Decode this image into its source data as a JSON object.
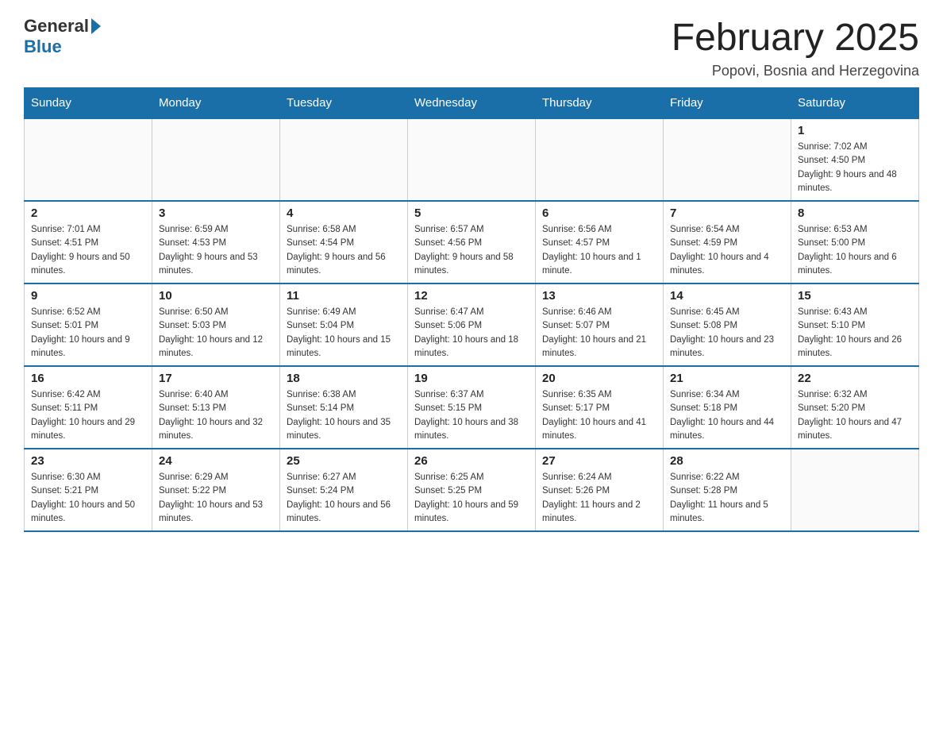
{
  "header": {
    "logo": {
      "general": "General",
      "blue": "Blue"
    },
    "title": "February 2025",
    "location": "Popovi, Bosnia and Herzegovina"
  },
  "days_of_week": [
    "Sunday",
    "Monday",
    "Tuesday",
    "Wednesday",
    "Thursday",
    "Friday",
    "Saturday"
  ],
  "weeks": [
    [
      {
        "day": "",
        "info": ""
      },
      {
        "day": "",
        "info": ""
      },
      {
        "day": "",
        "info": ""
      },
      {
        "day": "",
        "info": ""
      },
      {
        "day": "",
        "info": ""
      },
      {
        "day": "",
        "info": ""
      },
      {
        "day": "1",
        "info": "Sunrise: 7:02 AM\nSunset: 4:50 PM\nDaylight: 9 hours and 48 minutes."
      }
    ],
    [
      {
        "day": "2",
        "info": "Sunrise: 7:01 AM\nSunset: 4:51 PM\nDaylight: 9 hours and 50 minutes."
      },
      {
        "day": "3",
        "info": "Sunrise: 6:59 AM\nSunset: 4:53 PM\nDaylight: 9 hours and 53 minutes."
      },
      {
        "day": "4",
        "info": "Sunrise: 6:58 AM\nSunset: 4:54 PM\nDaylight: 9 hours and 56 minutes."
      },
      {
        "day": "5",
        "info": "Sunrise: 6:57 AM\nSunset: 4:56 PM\nDaylight: 9 hours and 58 minutes."
      },
      {
        "day": "6",
        "info": "Sunrise: 6:56 AM\nSunset: 4:57 PM\nDaylight: 10 hours and 1 minute."
      },
      {
        "day": "7",
        "info": "Sunrise: 6:54 AM\nSunset: 4:59 PM\nDaylight: 10 hours and 4 minutes."
      },
      {
        "day": "8",
        "info": "Sunrise: 6:53 AM\nSunset: 5:00 PM\nDaylight: 10 hours and 6 minutes."
      }
    ],
    [
      {
        "day": "9",
        "info": "Sunrise: 6:52 AM\nSunset: 5:01 PM\nDaylight: 10 hours and 9 minutes."
      },
      {
        "day": "10",
        "info": "Sunrise: 6:50 AM\nSunset: 5:03 PM\nDaylight: 10 hours and 12 minutes."
      },
      {
        "day": "11",
        "info": "Sunrise: 6:49 AM\nSunset: 5:04 PM\nDaylight: 10 hours and 15 minutes."
      },
      {
        "day": "12",
        "info": "Sunrise: 6:47 AM\nSunset: 5:06 PM\nDaylight: 10 hours and 18 minutes."
      },
      {
        "day": "13",
        "info": "Sunrise: 6:46 AM\nSunset: 5:07 PM\nDaylight: 10 hours and 21 minutes."
      },
      {
        "day": "14",
        "info": "Sunrise: 6:45 AM\nSunset: 5:08 PM\nDaylight: 10 hours and 23 minutes."
      },
      {
        "day": "15",
        "info": "Sunrise: 6:43 AM\nSunset: 5:10 PM\nDaylight: 10 hours and 26 minutes."
      }
    ],
    [
      {
        "day": "16",
        "info": "Sunrise: 6:42 AM\nSunset: 5:11 PM\nDaylight: 10 hours and 29 minutes."
      },
      {
        "day": "17",
        "info": "Sunrise: 6:40 AM\nSunset: 5:13 PM\nDaylight: 10 hours and 32 minutes."
      },
      {
        "day": "18",
        "info": "Sunrise: 6:38 AM\nSunset: 5:14 PM\nDaylight: 10 hours and 35 minutes."
      },
      {
        "day": "19",
        "info": "Sunrise: 6:37 AM\nSunset: 5:15 PM\nDaylight: 10 hours and 38 minutes."
      },
      {
        "day": "20",
        "info": "Sunrise: 6:35 AM\nSunset: 5:17 PM\nDaylight: 10 hours and 41 minutes."
      },
      {
        "day": "21",
        "info": "Sunrise: 6:34 AM\nSunset: 5:18 PM\nDaylight: 10 hours and 44 minutes."
      },
      {
        "day": "22",
        "info": "Sunrise: 6:32 AM\nSunset: 5:20 PM\nDaylight: 10 hours and 47 minutes."
      }
    ],
    [
      {
        "day": "23",
        "info": "Sunrise: 6:30 AM\nSunset: 5:21 PM\nDaylight: 10 hours and 50 minutes."
      },
      {
        "day": "24",
        "info": "Sunrise: 6:29 AM\nSunset: 5:22 PM\nDaylight: 10 hours and 53 minutes."
      },
      {
        "day": "25",
        "info": "Sunrise: 6:27 AM\nSunset: 5:24 PM\nDaylight: 10 hours and 56 minutes."
      },
      {
        "day": "26",
        "info": "Sunrise: 6:25 AM\nSunset: 5:25 PM\nDaylight: 10 hours and 59 minutes."
      },
      {
        "day": "27",
        "info": "Sunrise: 6:24 AM\nSunset: 5:26 PM\nDaylight: 11 hours and 2 minutes."
      },
      {
        "day": "28",
        "info": "Sunrise: 6:22 AM\nSunset: 5:28 PM\nDaylight: 11 hours and 5 minutes."
      },
      {
        "day": "",
        "info": ""
      }
    ]
  ]
}
